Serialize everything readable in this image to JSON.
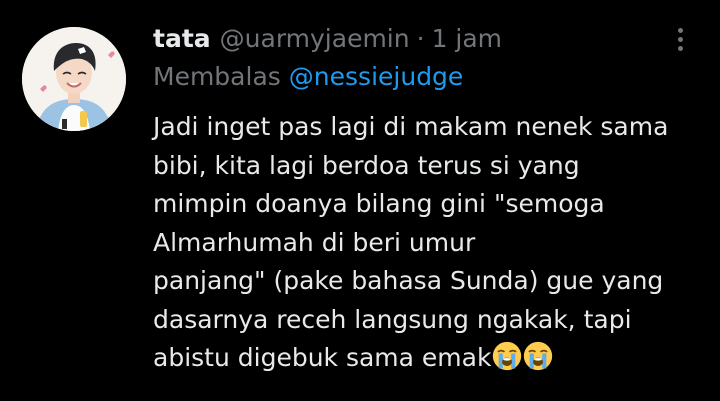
{
  "tweet": {
    "display_name": "tata",
    "handle": "@uarmyjaemin",
    "separator": "·",
    "time": "1 jam",
    "reply_prefix": "Membalas",
    "reply_to": "@nessiejudge",
    "text_lines": [
      "Jadi inget pas lagi di makam nenek sama",
      "bibi, kita lagi berdoa terus si yang",
      "mimpin doanya bilang gini \"semoga",
      "Almarhumah di beri umur",
      "panjang\" (pake bahasa Sunda) gue yang",
      "dasarnya receh langsung ngakak, tapi",
      "abistu digebuk sama emak"
    ],
    "trailing_emojis": [
      "loudly-crying-face",
      "loudly-crying-face"
    ]
  },
  "icons": {
    "more": "more-options-icon",
    "emoji": "loudly-crying-face-emoji"
  },
  "colors": {
    "background": "#000000",
    "primary_text": "#e7e9ea",
    "secondary_text": "#71767b",
    "mention": "#1d9bf0",
    "emoji_face": "#ffcc4d",
    "emoji_tears": "#5dadec"
  }
}
